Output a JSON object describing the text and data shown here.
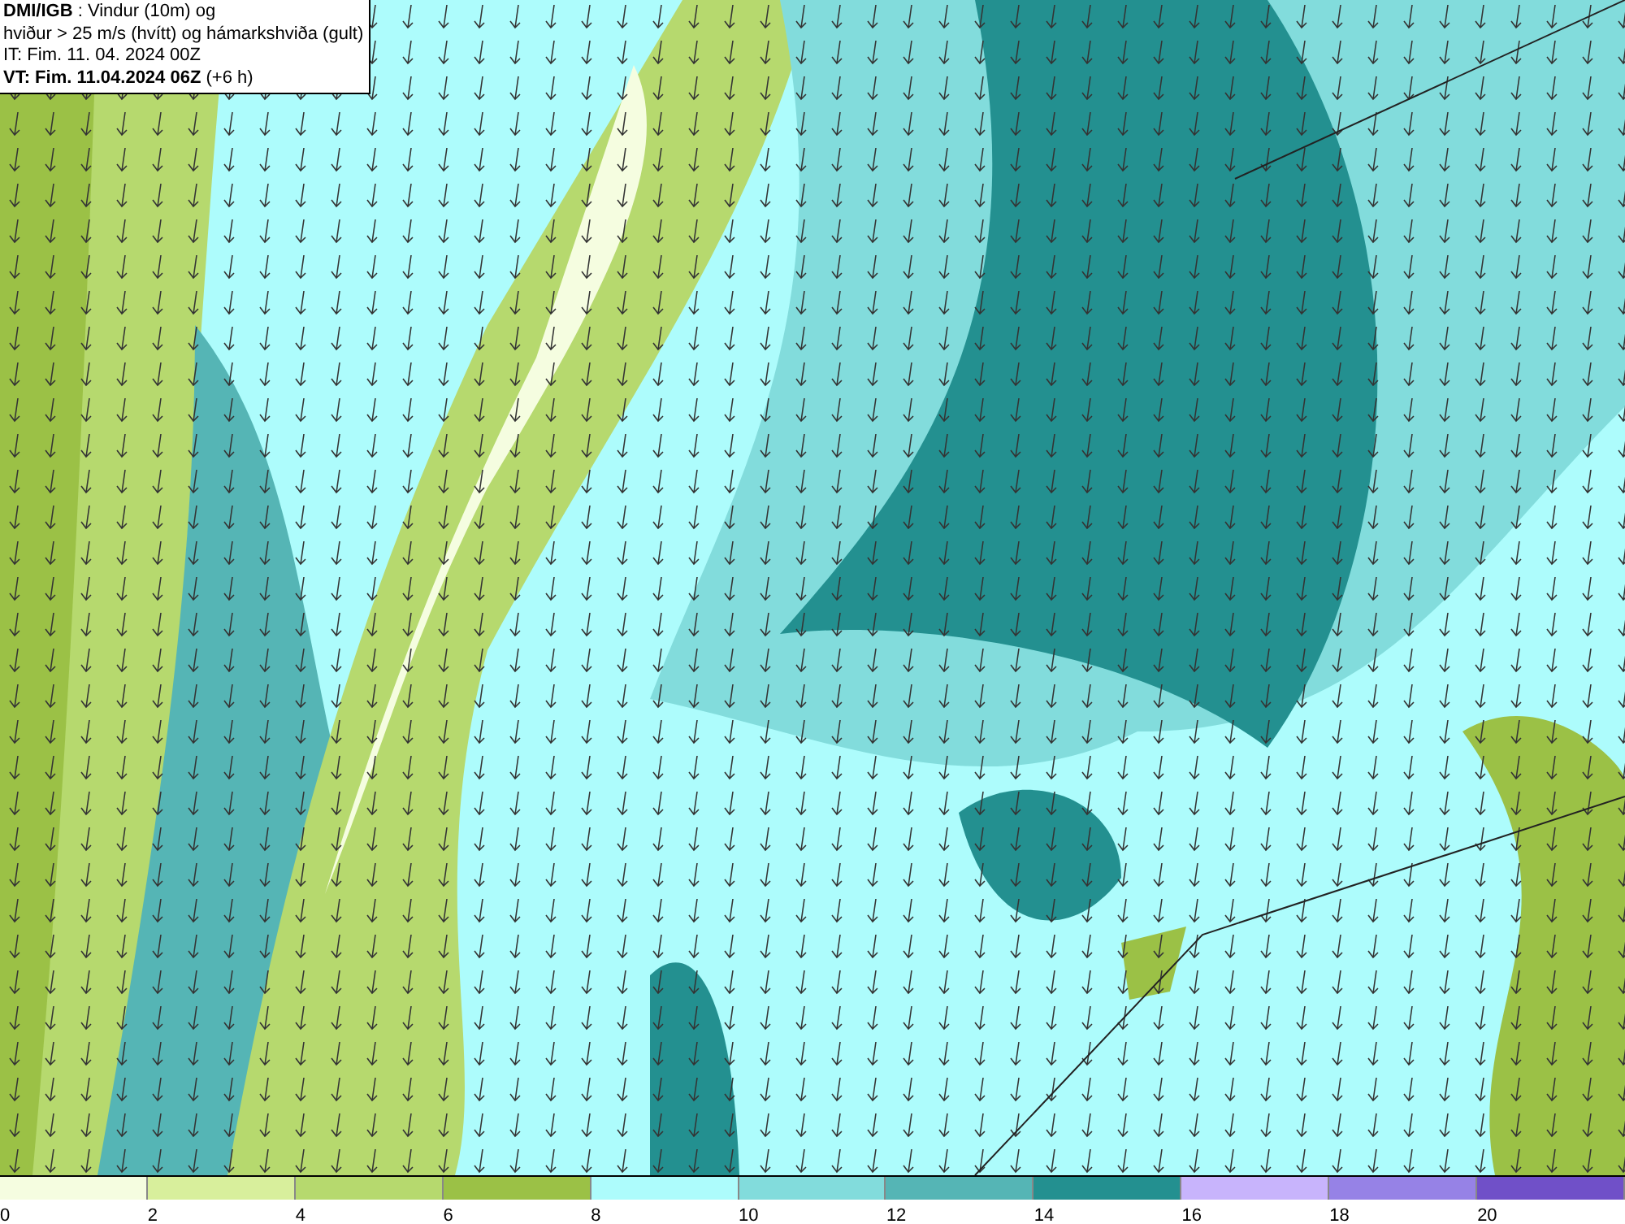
{
  "title_box": {
    "lines": [
      "**DMI/IGB** : Vindur (10m) og",
      "hviður > 25 m/s (hvítt) og hámarkshviða (gult)",
      "IT: Fim. 11. 04. 2024 00Z",
      "**VT: Fim. 11.04.2024 06Z** (+6 h)"
    ]
  },
  "legend": {
    "bins": [
      {
        "color": "#f5fde0",
        "label": "0"
      },
      {
        "color": "#d8ef9c",
        "label": "2"
      },
      {
        "color": "#b6d96e",
        "label": "4"
      },
      {
        "color": "#9bc146",
        "label": "6"
      },
      {
        "color": "#adfcfc",
        "label": "8"
      },
      {
        "color": "#82dcdc",
        "label": "10"
      },
      {
        "color": "#55b5b5",
        "label": "12"
      },
      {
        "color": "#239090",
        "label": "14"
      },
      {
        "color": "#c8b4fc",
        "label": "16"
      },
      {
        "color": "#9682e6",
        "label": "18"
      },
      {
        "color": "#7050c8",
        "label": "20"
      }
    ]
  }
}
